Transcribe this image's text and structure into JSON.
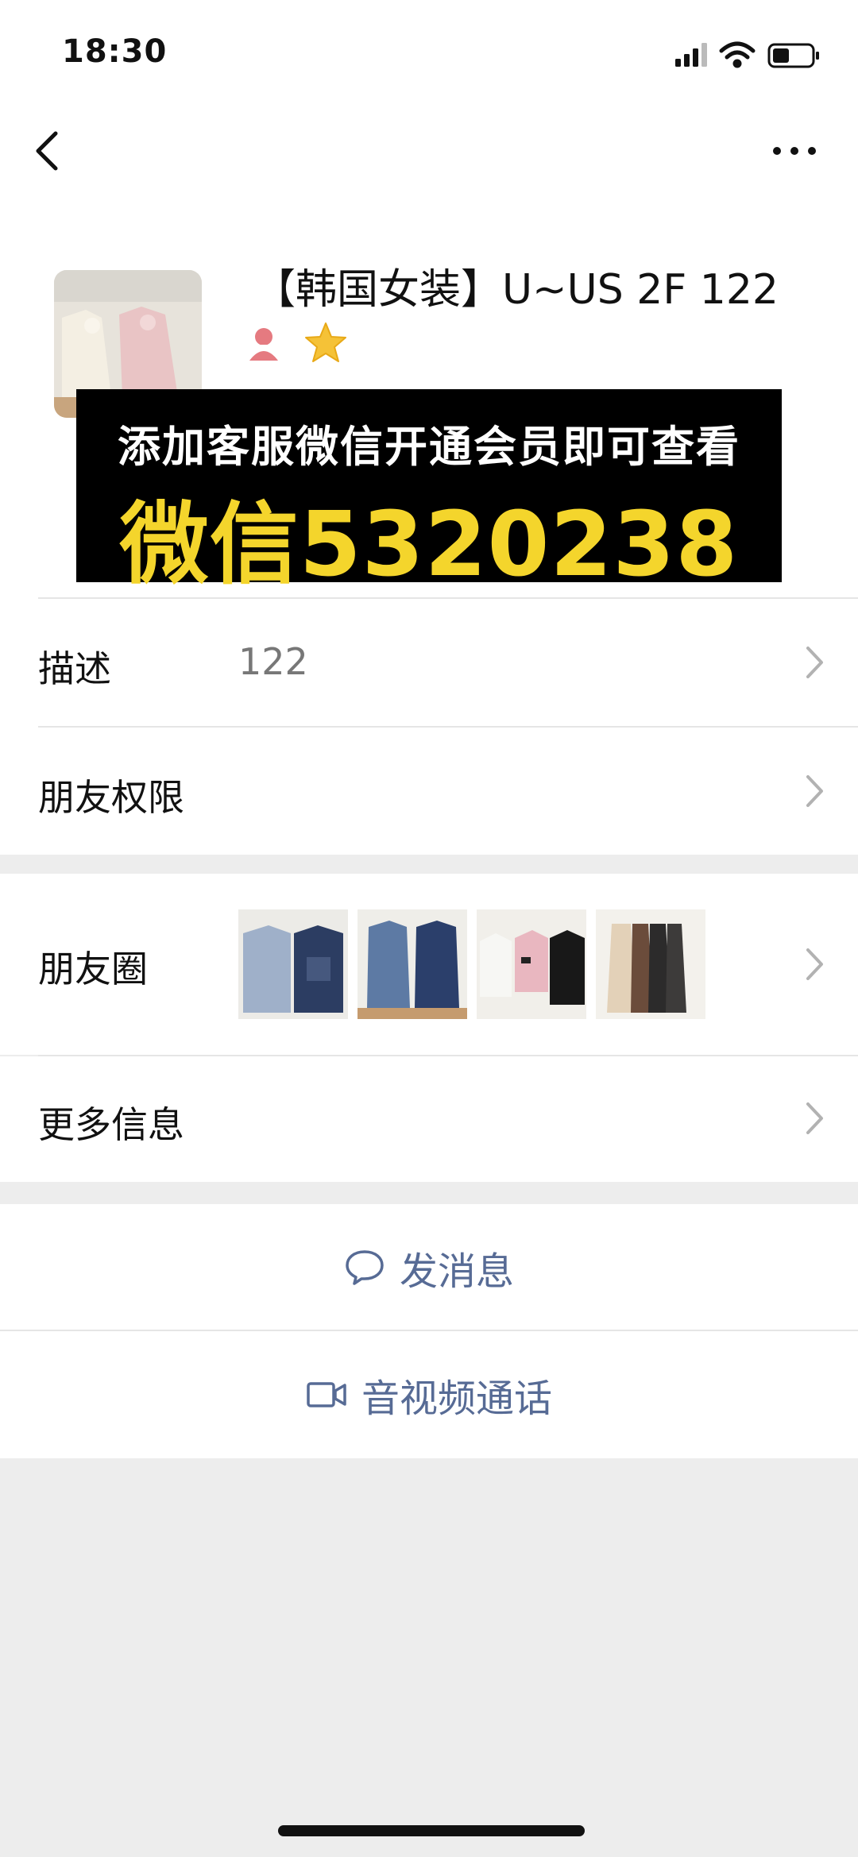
{
  "status_bar": {
    "time": "18:30",
    "signal_icon": "cellular-signal-icon",
    "wifi_icon": "wifi-icon",
    "battery_icon": "battery-icon"
  },
  "nav": {
    "back_icon": "chevron-left-icon",
    "more_icon": "more-dots-icon"
  },
  "profile": {
    "name": "【韩国女装】U~US 2F 122",
    "gender_icon": "female-user-icon",
    "star_icon": "star-icon"
  },
  "banner": {
    "line1": "添加客服微信开通会员即可查看",
    "line2": "微信5320238",
    "text_color": "#ffffff",
    "highlight_color": "#f4d52c"
  },
  "rows": {
    "description": {
      "label": "描述",
      "value": "122"
    },
    "permissions": {
      "label": "朋友权限"
    },
    "moments": {
      "label": "朋友圈",
      "thumb_count": 4
    },
    "more_info": {
      "label": "更多信息"
    }
  },
  "actions": {
    "message": {
      "label": "发消息",
      "icon": "chat-bubble-icon"
    },
    "call": {
      "label": "音视频通话",
      "icon": "video-camera-icon"
    }
  },
  "colors": {
    "link": "#576b95",
    "background": "#ededed"
  }
}
